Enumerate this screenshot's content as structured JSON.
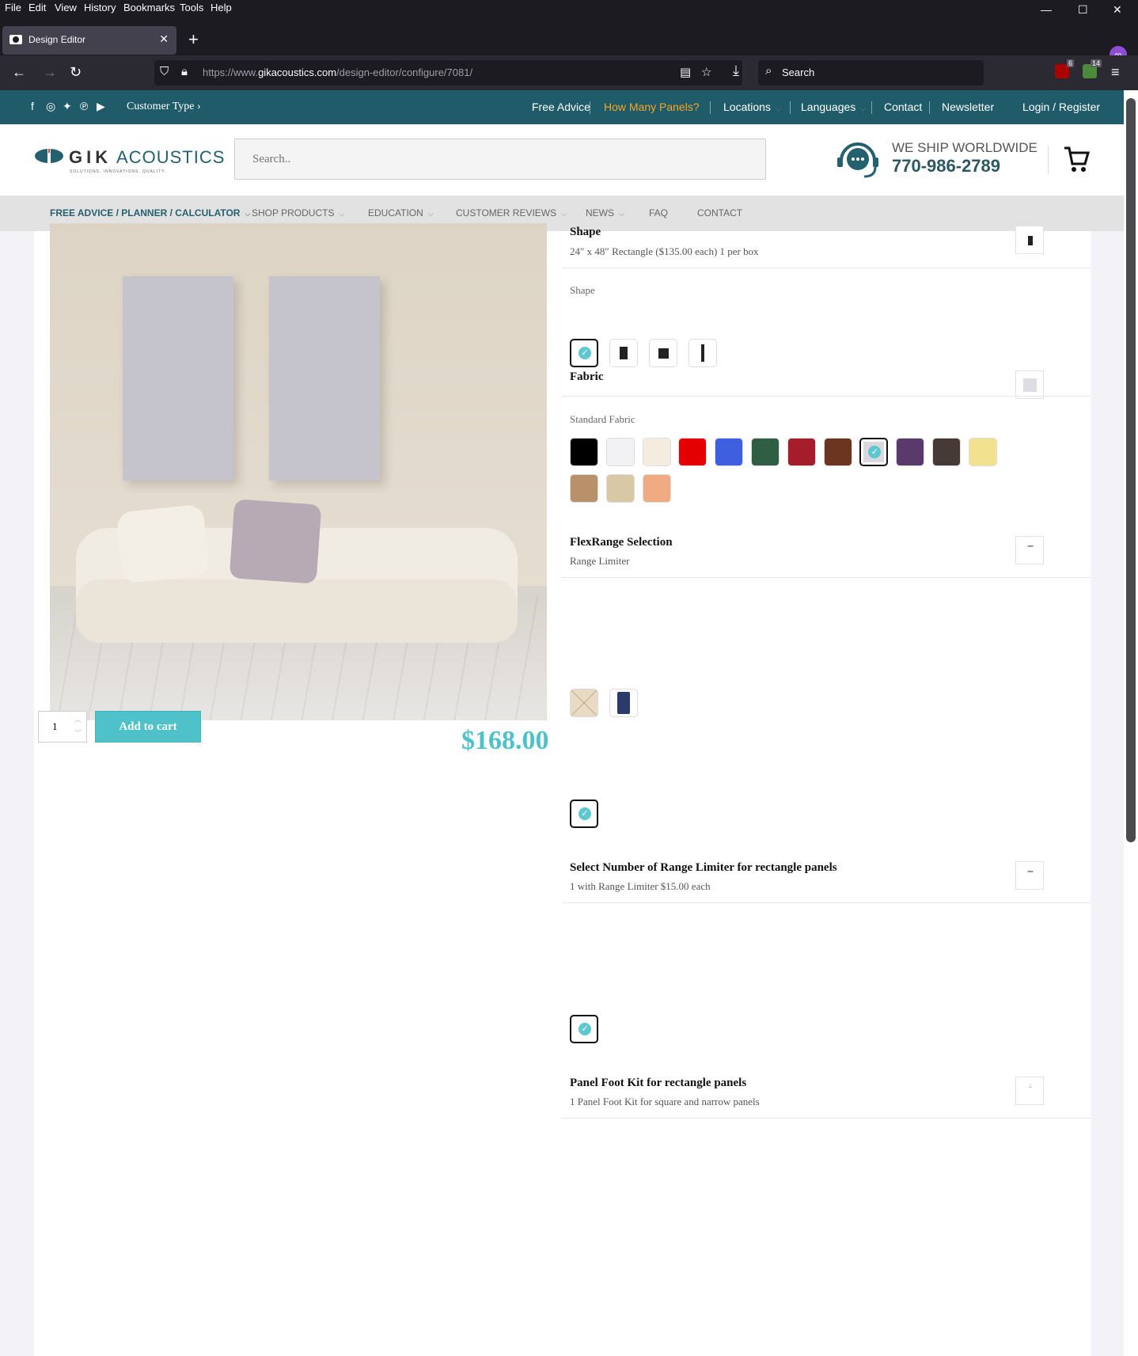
{
  "browser": {
    "menu": [
      "File",
      "Edit",
      "View",
      "History",
      "Bookmarks",
      "Tools",
      "Help"
    ],
    "tab_title": "Design Editor",
    "url_prefix": "https://www.",
    "url_domain": "gikacoustics.com",
    "url_path": "/design-editor/configure/7081/",
    "search_placeholder": "Search",
    "ext_badges": [
      "6",
      "14"
    ]
  },
  "topbar": {
    "customer_type": "Customer Type ›",
    "links": [
      "Free Advice",
      "How Many Panels?",
      "Locations",
      "Languages",
      "Contact",
      "Newsletter",
      "Login / Register"
    ]
  },
  "header": {
    "logo_word": "GIK",
    "logo_word2": "ACOUSTICS",
    "logo_tagline": "SOLUTIONS. INNOVATIONS. QUALITY.",
    "search_placeholder": "Search..",
    "ship": "WE SHIP WORLDWIDE",
    "phone": "770-986-2789"
  },
  "catnav": [
    "FREE ADVICE / PLANNER / CALCULATOR",
    "SHOP PRODUCTS",
    "EDUCATION",
    "CUSTOMER REVIEWS",
    "NEWS",
    "FAQ",
    "CONTACT"
  ],
  "product": {
    "qty": "1",
    "add_to_cart": "Add to cart",
    "price": "$168.00"
  },
  "options": {
    "shape": {
      "title": "Shape",
      "subtitle": "24″ x 48″ Rectangle ($135.00 each) 1 per box",
      "label": "Shape"
    },
    "fabric": {
      "title": "Fabric",
      "label": "Standard Fabric",
      "colors": [
        "#000000",
        "#f2f2f4",
        "#f3ecdf",
        "#e50000",
        "#3e5fe0",
        "#2f5e45",
        "#a51d2a",
        "#6b3520",
        "#d8d8de",
        "#5a3a6c",
        "#463a37",
        "#f2e18e",
        "#b8906a",
        "#d8c8a6",
        "#f0ab82"
      ],
      "selected_index": 8
    },
    "flexrange": {
      "title": "FlexRange Selection",
      "subtitle": "Range Limiter"
    },
    "range_limiter": {
      "title": "Select Number of Range Limiter for rectangle panels",
      "subtitle": "1 with Range Limiter $15.00 each"
    },
    "foot_kit": {
      "title": "Panel Foot Kit for rectangle panels",
      "subtitle": "1 Panel Foot Kit for square and narrow panels"
    }
  }
}
